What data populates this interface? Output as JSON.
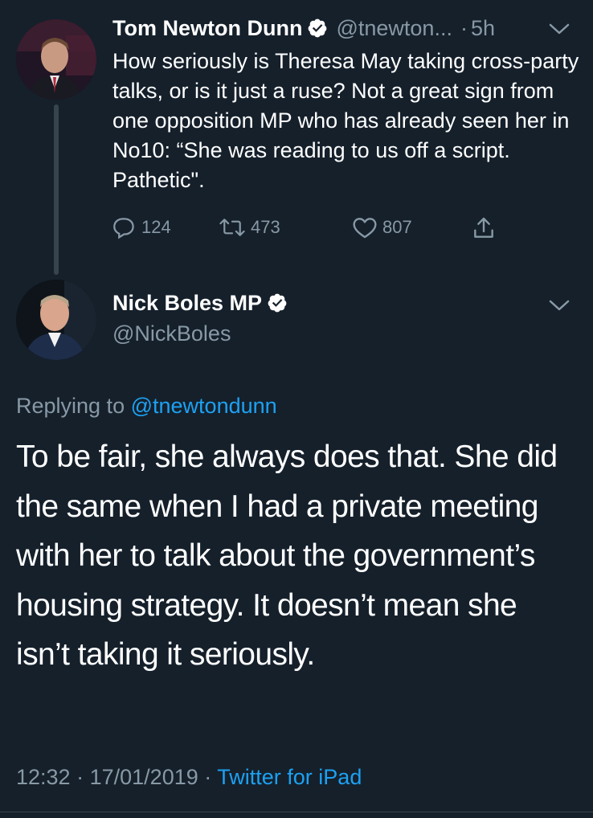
{
  "parent_tweet": {
    "author_name": "Tom Newton Dunn",
    "handle": "@tnewton...",
    "separator": "·",
    "time": "5h",
    "text": "How seriously is Theresa May taking cross-party talks, or is it just a ruse? Not a great sign from one opposition MP who has already seen her in No10: “She was reading to us off a script. Pathetic\".",
    "actions": {
      "replies": "124",
      "retweets": "473",
      "likes": "807"
    }
  },
  "tweet": {
    "author_name": "Nick Boles MP",
    "handle": "@NickBoles",
    "replying_prefix": "Replying to",
    "replying_handle": "@tnewtondunn",
    "text": "To be fair, she always does that. She did the same when I had a private meeting with her to talk about the government’s housing strategy. It doesn’t mean she isn’t taking it seriously.",
    "time": "12:32",
    "separator": "·",
    "date": "17/01/2019",
    "separator2": "·",
    "source": "Twitter for iPad"
  },
  "colors": {
    "background": "#15202b",
    "muted": "#8899a6",
    "accent": "#1da1f2",
    "divider": "#38444d"
  },
  "icons": [
    "verified-badge-icon",
    "chevron-down-icon",
    "reply-icon",
    "retweet-icon",
    "like-icon",
    "share-icon"
  ]
}
